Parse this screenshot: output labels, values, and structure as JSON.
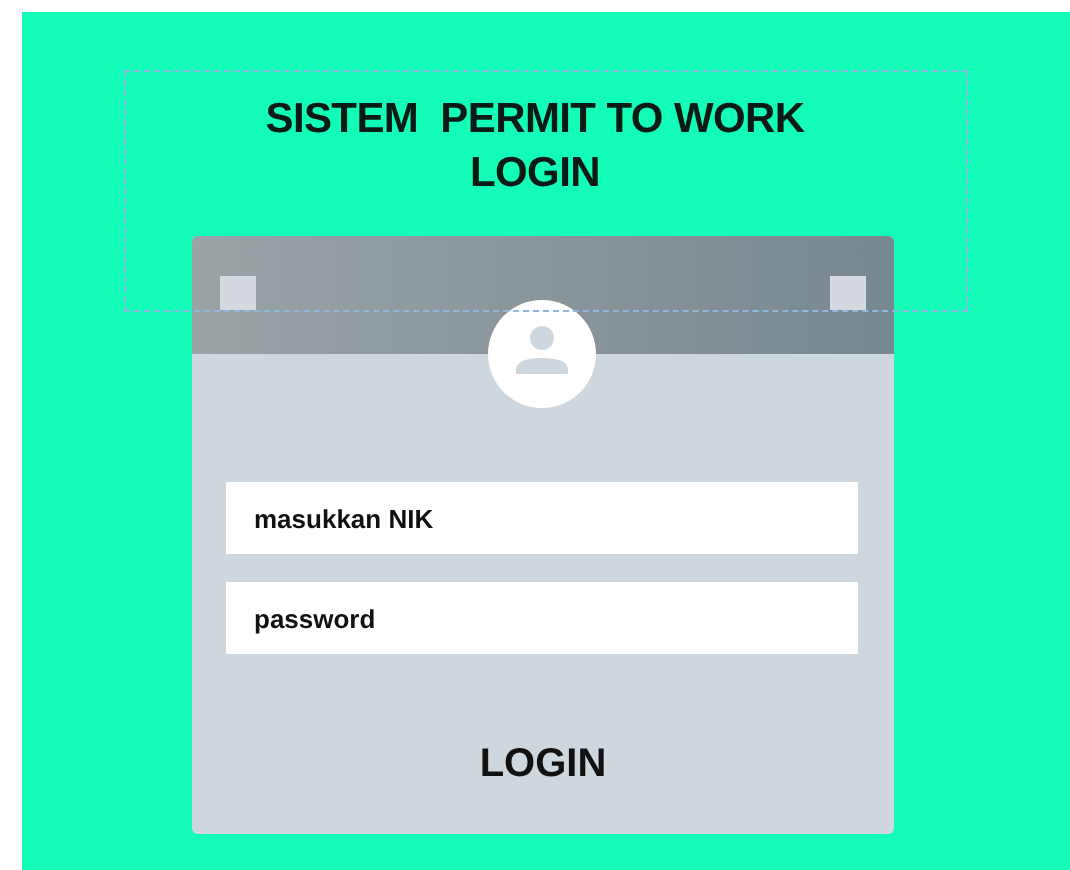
{
  "title_lines": [
    "SISTEM  PERMIT TO WORK",
    "LOGIN"
  ],
  "fields": [
    {
      "placeholder": "masukkan NIK"
    },
    {
      "placeholder": "password"
    }
  ],
  "login_button": "LOGIN"
}
